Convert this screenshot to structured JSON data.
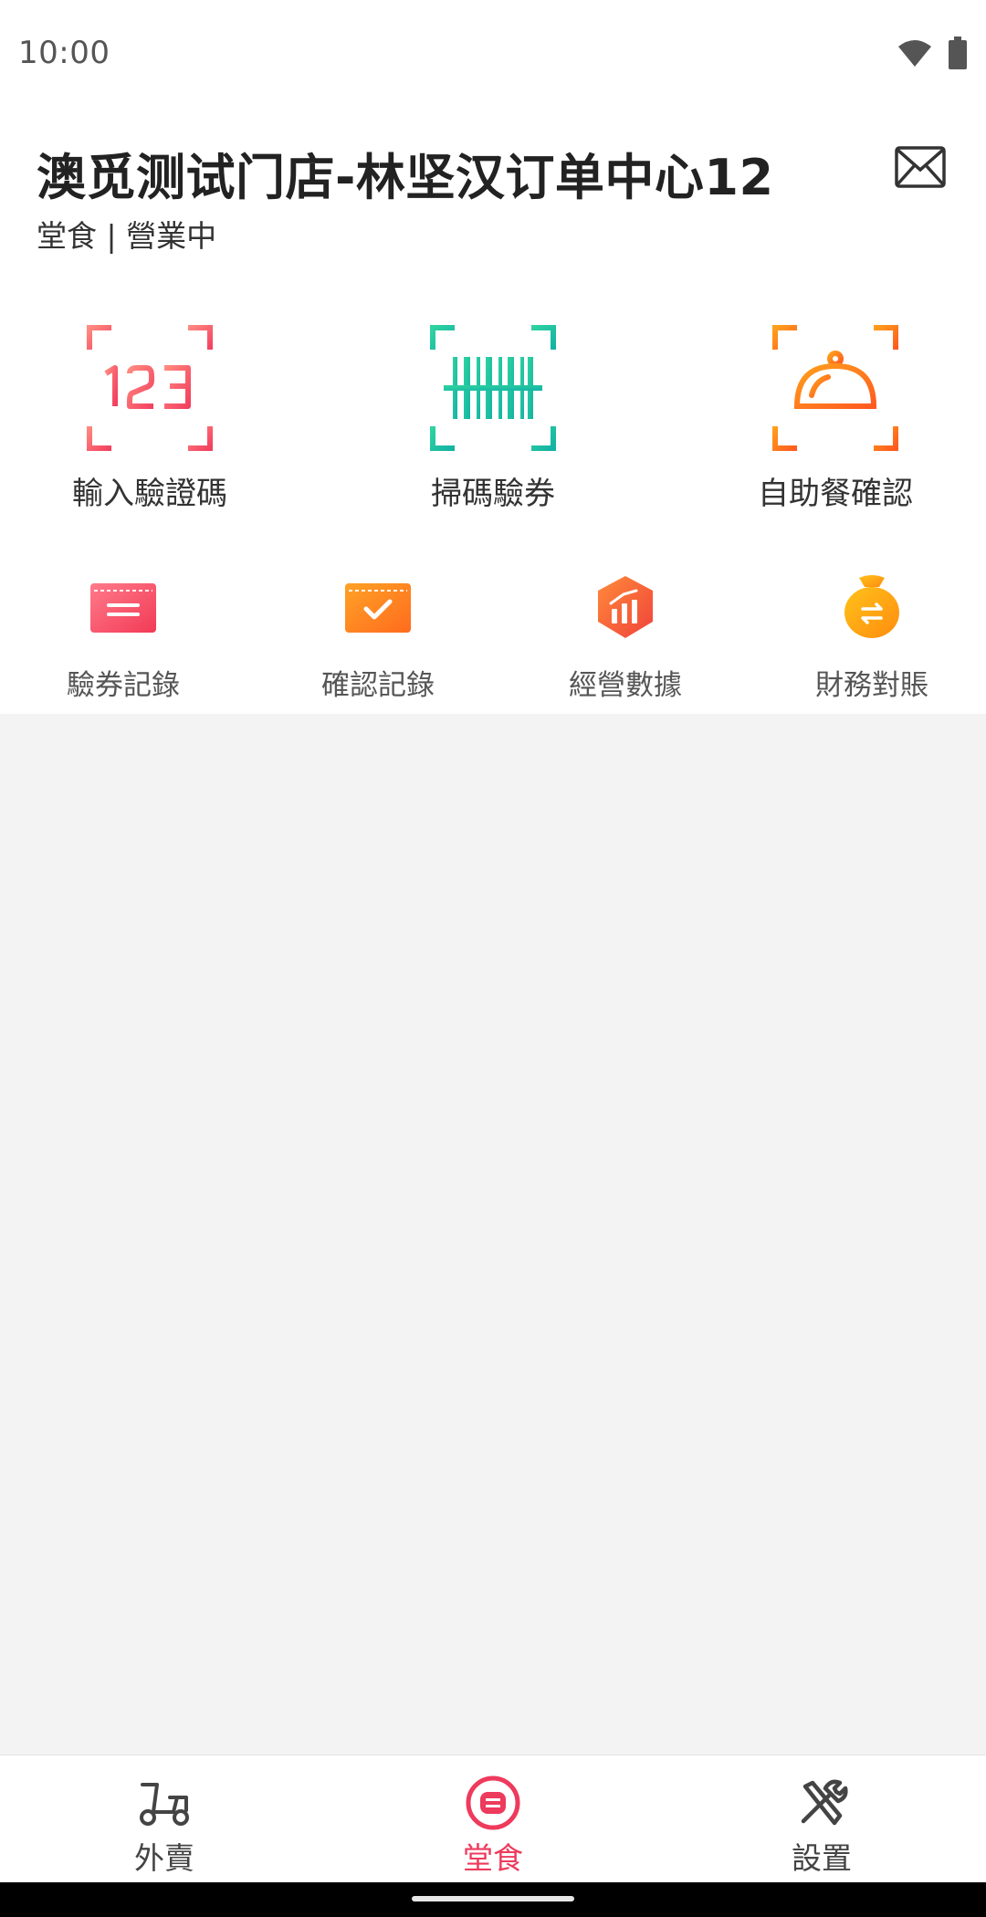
{
  "status_bar": {
    "time": "10:00"
  },
  "header": {
    "store_name": "澳觅测试门店-林坚汉订单中心12",
    "subtitle": "堂食 | 營業中"
  },
  "big_actions": [
    {
      "label": "輸入驗證碼",
      "icon": "number-123-scan-icon"
    },
    {
      "label": "掃碼驗券",
      "icon": "barcode-scan-icon"
    },
    {
      "label": "自助餐確認",
      "icon": "food-cloche-icon"
    }
  ],
  "small_actions": [
    {
      "label": "驗券記錄",
      "icon": "coupon-record-icon"
    },
    {
      "label": "確認記錄",
      "icon": "confirm-record-icon"
    },
    {
      "label": "經營數據",
      "icon": "business-data-icon"
    },
    {
      "label": "財務對賬",
      "icon": "money-bag-icon"
    }
  ],
  "bottom_nav": [
    {
      "label": "外賣",
      "icon": "scooter-icon",
      "active": false
    },
    {
      "label": "堂食",
      "icon": "dine-in-icon",
      "active": true
    },
    {
      "label": "設置",
      "icon": "tools-icon",
      "active": false
    }
  ],
  "colors": {
    "accent_pink": "#ee3a5c",
    "teal": "#1fbf9f",
    "orange": "#ff7a1a"
  }
}
